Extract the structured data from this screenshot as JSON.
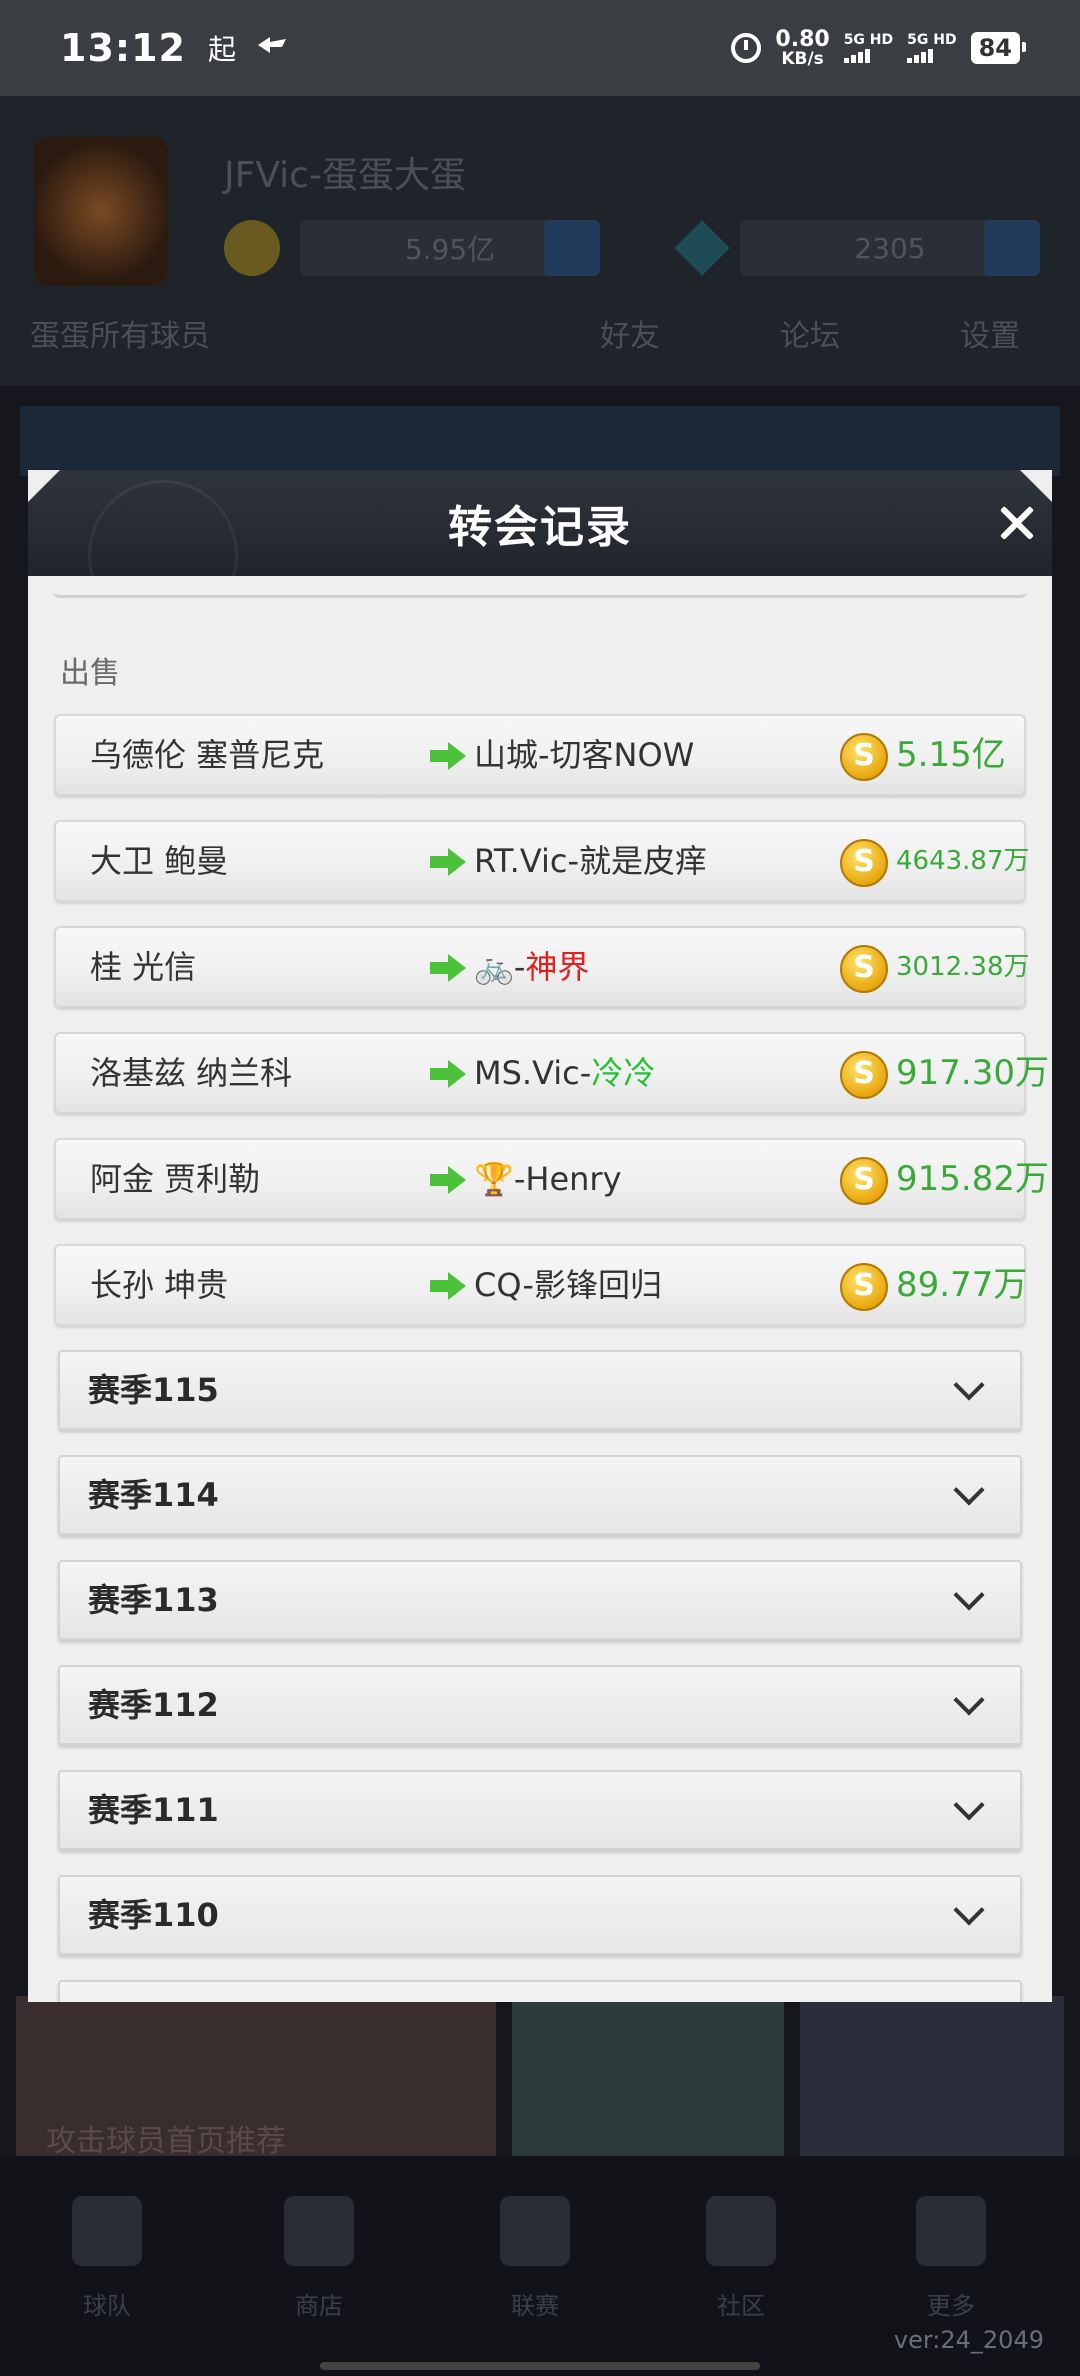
{
  "status_bar": {
    "time": "13:12",
    "carrier": "起",
    "net_speed_value": "0.80",
    "net_speed_unit": "KB/s",
    "sim1": "5G HD",
    "sim2": "5G HD",
    "battery": "84"
  },
  "background": {
    "team_name": "JFVic-蛋蛋大蛋",
    "coins": "5.95亿",
    "gems": "2305",
    "nav_left": "蛋蛋所有球员",
    "nav_items": [
      "好友",
      "论坛",
      "设置"
    ],
    "tabs": [
      "球队",
      "商店",
      "联赛",
      "社区",
      "更多"
    ],
    "banner_text": "攻击球员首页推荐",
    "version": "ver:24_2049"
  },
  "modal": {
    "title": "转会记录",
    "section_label": "出售",
    "transfers": [
      {
        "player": "乌德伦 塞普尼克",
        "dest": "山城-切客NOW",
        "dest_highlight": "",
        "price": "5.15亿"
      },
      {
        "player": "大卫 鲍曼",
        "dest": "RT.Vic-就是皮痒",
        "dest_highlight": "",
        "price": "4643.87万"
      },
      {
        "player": "桂 光信",
        "dest": "🚲-",
        "dest_highlight": "神界",
        "price": "3012.38万"
      },
      {
        "player": "洛基兹 纳兰科",
        "dest": "MS.Vic-",
        "dest_highlight": "冷冷",
        "price": "917.30万"
      },
      {
        "player": "阿金 贾利勒",
        "dest": "🏆-Henry",
        "dest_highlight": "",
        "price": "915.82万"
      },
      {
        "player": "长孙 坤贵",
        "dest": "CQ-影锋回归",
        "dest_highlight": "",
        "price": "89.77万"
      }
    ],
    "seasons": [
      "赛季115",
      "赛季114",
      "赛季113",
      "赛季112",
      "赛季111",
      "赛季110"
    ]
  },
  "colors": {
    "price_green": "#3aa93a",
    "arrow_green": "#4cc23a",
    "highlight_red": "#e02020",
    "highlight_green": "#22c232"
  }
}
